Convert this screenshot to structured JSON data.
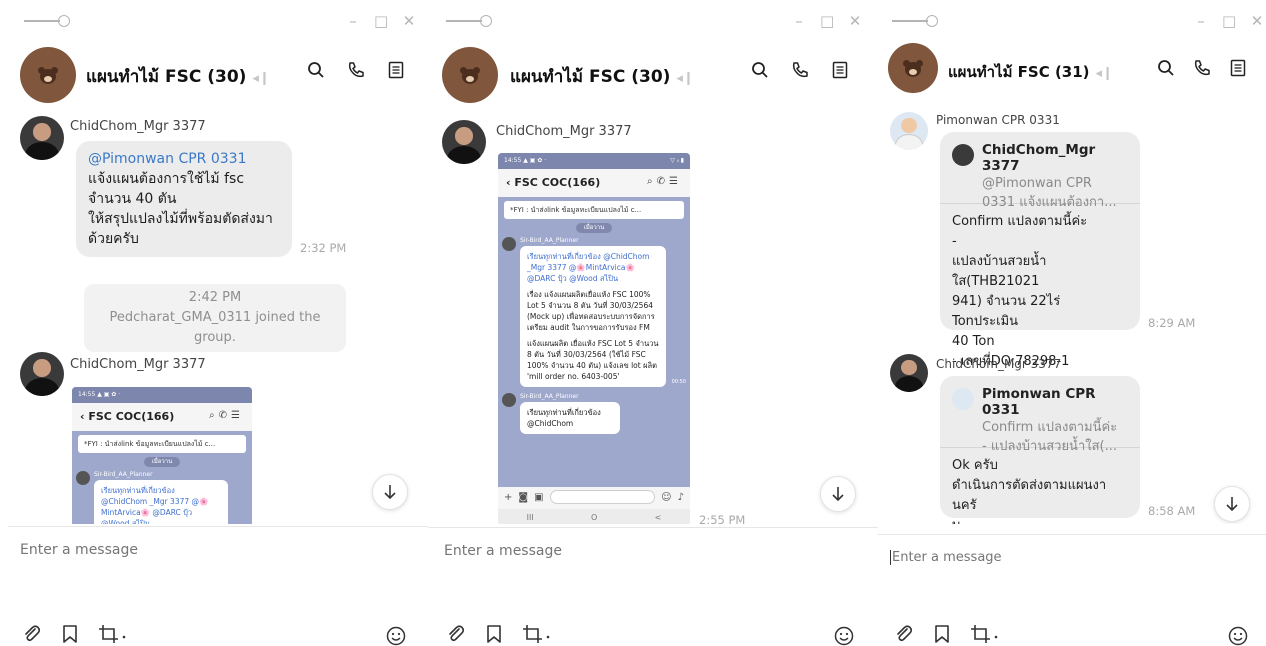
{
  "windows": [
    {
      "chat_title": "แผนทำไม้ FSC (30)",
      "messages": {
        "m1_sender": "ChidChom_Mgr 3377",
        "m1_mention": "@Pimonwan CPR 0331",
        "m1_lines": [
          "แจ้งแผนต้องการใช้ไม้ fsc",
          "จำนวน 40 ตัน",
          "ให้สรุปแปลงไม้ที่พร้อมตัดส่งมา",
          "ด้วยครับ"
        ],
        "m1_time": "2:32 PM",
        "sys_time": "2:42 PM",
        "sys_text": "Pedcharat_GMA_0311 joined the group.",
        "m2_sender": "ChidChom_Mgr 3377"
      },
      "input_placeholder": "Enter a message"
    },
    {
      "chat_title": "แผนทำไม้ FSC (30)",
      "messages": {
        "m1_sender": "ChidChom_Mgr 3377",
        "m1_time": "2:55 PM"
      },
      "input_placeholder": "Enter a message"
    },
    {
      "chat_title": "แผนทำไม้ FSC (31)",
      "messages": {
        "m1_sender": "Pimonwan CPR 0331",
        "m1_quote_name": "ChidChom_Mgr 3377",
        "m1_quote_lines": [
          "@Pimonwan CPR",
          "0331  แจ้งแผนต้องกา..."
        ],
        "m1_lines": [
          "Confirm แปลงตามนี้ค่ะ",
          "-",
          "แปลงบ้านสวยน้ำใส(THB21021",
          "941) จำนวน 22ไร่ Tonประเมิน",
          "40 Ton",
          "- เลขที่DO:78298-1"
        ],
        "m1_time": "8:29 AM",
        "m2_sender": "ChidChom_Mgr 3377",
        "m2_quote_name": "Pimonwan CPR 0331",
        "m2_quote_lines": [
          "Confirm แปลงตามนี้ค่ะ",
          "- แปลงบ้านสวยน้ำใส(..."
        ],
        "m2_lines": [
          "Ok ครับ",
          "ดำเนินการตัดส่งตามแผนงานครั",
          "บ"
        ],
        "m2_time": "8:58 AM"
      },
      "input_placeholder": "Enter a message"
    }
  ],
  "phone_screenshot": {
    "status_left": "14:55 ▲ ▣ ✿ ·",
    "status_right": "▽ ᵢₗ ▮",
    "chat_name": "FSC COC(166)",
    "fyi_text": "*FYI : นำส่งlink ข้อมูลทะเบียนแปลงไม้ c...",
    "pill": "เมื่อวาน",
    "poster": "Sir-Bird_AA_Planner",
    "msg1_mention": "เรียนทุกท่านที่เกี่ยวข้อง @ChidChom _Mgr 3377 @🌸MintArvica🌸 @DARC ปุ้ว @Wood สไปิน",
    "msg1_body": "เรื่อง แจ้งแผนผลิตเยื่อแห้ง FSC 100% Lot 5 จำนวน 8 ตัน วันที่ 30/03/2564 (Mock up) เพื่อทดสอบระบบการจัดการเตรียม audit ในการขอการรับรอง FM",
    "msg1_body2": "แจ้งแผนผลิต เยื่อแห้ง FSC Lot 5 จำนวน 8 ตัน วันที่ 30/03/2564 (ใช้ไม้ FSC 100% จำนวน 40 ตัน) แจ้งเลข lot ผลิต 'mill order no. 6403-005'",
    "msg1_time": "00:50",
    "msg2": "เรียนทุกท่านที่เกี่ยวข้อง @ChidChom",
    "msg2_time": "00:50",
    "nav": [
      "III",
      "O",
      "<"
    ]
  },
  "icons": {
    "search": "search-icon",
    "call": "phone-icon",
    "notes": "notes-icon",
    "more": "more-vertical-icon",
    "attach": "paperclip-icon",
    "bookmark": "bookmark-icon",
    "screenshot": "crop-icon",
    "emoji": "emoji-icon",
    "scroll": "arrow-down-icon"
  },
  "colors": {
    "mention": "#3b79c8",
    "bubble": "#ececec",
    "group_avatar": "#80563d"
  }
}
